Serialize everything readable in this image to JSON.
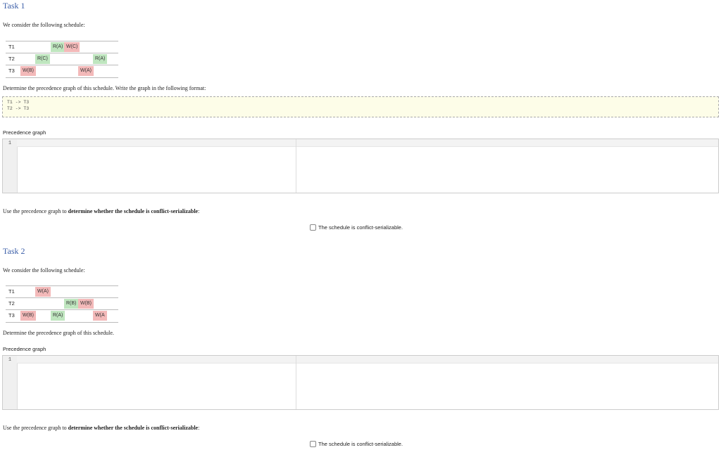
{
  "task1": {
    "title": "Task 1",
    "intro": "We consider the following schedule:",
    "schedule": {
      "t1": "T1",
      "t2": "T2",
      "t3": "T3",
      "ops": [
        "R(A)",
        "W(C)",
        "R(C)",
        "R(A)",
        "W(B)",
        "W(A)"
      ]
    },
    "instruction": "Determine the precedence graph of this schedule. Write the graph in the following format:",
    "format_example": "T1 -> T3\nT2 -> T3",
    "graph_label": "Precedence graph",
    "line_number": "1",
    "serial_question_pre": "Use the precedence graph to ",
    "serial_question_bold": "determine whether the schedule is conflict-serializable",
    "serial_question_post": ":",
    "checkbox_label": "The schedule is conflict-serializable."
  },
  "task2": {
    "title": "Task 2",
    "intro": "We consider the following schedule:",
    "schedule": {
      "t1": "T1",
      "t2": "T2",
      "t3": "T3",
      "ops": [
        "W(A)",
        "R(B)",
        "W(B)",
        "W(B)",
        "R(A)",
        "W(A"
      ]
    },
    "instruction": "Determine the precedence graph of this schedule.",
    "graph_label": "Precedence graph",
    "line_number": "1",
    "serial_question_pre": "Use the precedence graph to ",
    "serial_question_bold": "determine whether the schedule is conflict-serializable",
    "serial_question_post": ":",
    "checkbox_label": "The schedule is conflict-serializable."
  }
}
